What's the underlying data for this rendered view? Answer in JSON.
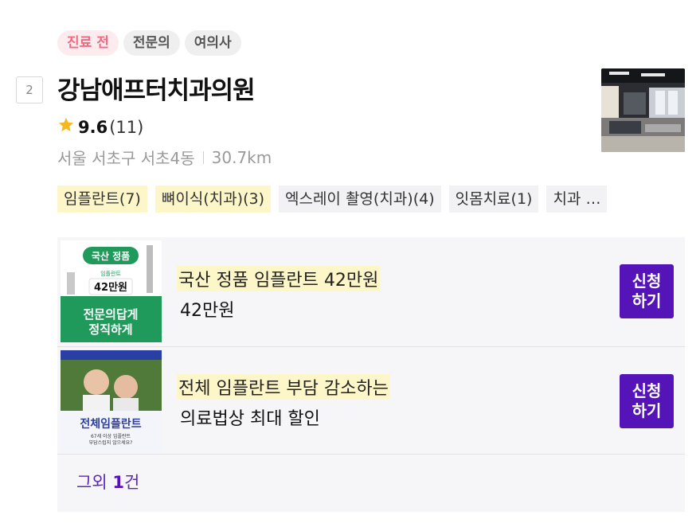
{
  "badges": [
    {
      "label": "진료 전",
      "color": "#f06a82"
    },
    {
      "label": "전문의"
    },
    {
      "label": "여의사"
    }
  ],
  "listing": {
    "rank": "2",
    "name": "강남애프터치과의원",
    "star_icon": "star-icon",
    "rating": "9.6",
    "review_count": "(11)",
    "location": "서울 서초구 서초4동",
    "distance": "30.7km",
    "tags": [
      {
        "label": "임플란트(7)",
        "highlight": true
      },
      {
        "label": "뼈이식(치과)(3)",
        "highlight": true
      },
      {
        "label": "엑스레이 촬영(치과)(4)",
        "highlight": false
      },
      {
        "label": "잇몸치료(1)",
        "highlight": false
      },
      {
        "label": "치과 …",
        "highlight": false
      }
    ]
  },
  "offers": [
    {
      "title": "국산 정품 임플란트 42만원",
      "subtitle": "42만원",
      "button": "신청\n하기",
      "image_text": {
        "badge": "국산 정품",
        "small": "임플란트",
        "price": "42만원",
        "line1": "전문의답게",
        "line2": "정직하게"
      }
    },
    {
      "title": "전체 임플란트 부담 감소하는",
      "subtitle": "의료법상 최대 할인",
      "button": "신청\n하기",
      "image_text": {
        "main": "전체임플란트",
        "small1": "67세 이상 임플란트",
        "small2": "부담스럽지 않으세요?"
      }
    }
  ],
  "more": {
    "prefix": "그외 ",
    "count": "1",
    "suffix": "건"
  },
  "colors": {
    "accent": "#5414b8",
    "highlight": "#fdf6c8",
    "pink": "#f06a82",
    "star": "#f6b81e"
  }
}
